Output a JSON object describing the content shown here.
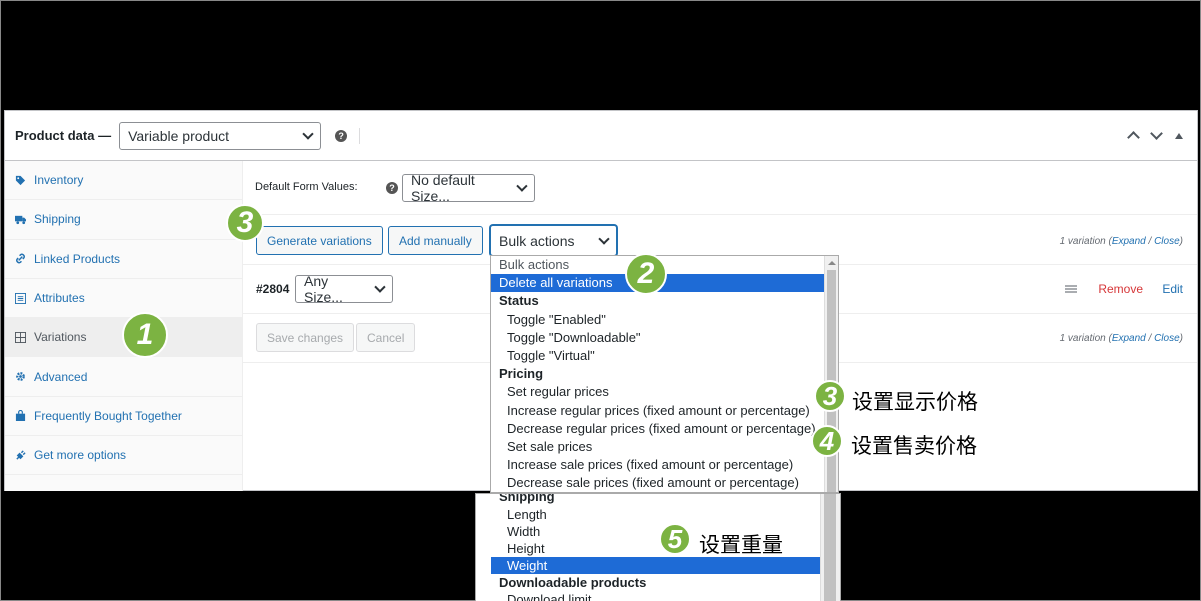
{
  "header": {
    "title": "Product data —",
    "product_type": "Variable product",
    "help": "?"
  },
  "tabs": [
    {
      "label": "Inventory",
      "icon": "tag-icon"
    },
    {
      "label": "Shipping",
      "icon": "truck-icon"
    },
    {
      "label": "Linked Products",
      "icon": "link-icon"
    },
    {
      "label": "Attributes",
      "icon": "list-icon"
    },
    {
      "label": "Variations",
      "icon": "grid-icon",
      "active": true
    },
    {
      "label": "Advanced",
      "icon": "gear-icon"
    },
    {
      "label": "Frequently Bought Together",
      "icon": "bag-icon"
    },
    {
      "label": "Get more options",
      "icon": "plugin-icon"
    }
  ],
  "default_form": {
    "label": "Default Form Values:",
    "help": "?",
    "select_value": "No default Size..."
  },
  "toolbar": {
    "generate": "Generate variations",
    "add_manually": "Add manually",
    "bulk_actions": "Bulk actions",
    "count_text": "1 variation (",
    "expand": "Expand",
    "slash": " / ",
    "close": "Close",
    "count_end": ")"
  },
  "variation": {
    "id": "#2804",
    "size": "Any Size...",
    "remove": "Remove",
    "edit": "Edit"
  },
  "footer": {
    "save": "Save changes",
    "cancel": "Cancel",
    "count_text": "1 variation (",
    "expand": "Expand",
    "slash": " / ",
    "close": "Close",
    "count_end": ")"
  },
  "dropdown": {
    "first": "Bulk actions",
    "selected": "Delete all variations",
    "status_group": "Status",
    "status_items": [
      "Toggle \"Enabled\"",
      "Toggle \"Downloadable\"",
      "Toggle \"Virtual\""
    ],
    "pricing_group": "Pricing",
    "pricing_items": [
      "Set regular prices",
      "Increase regular prices (fixed amount or percentage)",
      "Decrease regular prices (fixed amount or percentage)",
      "Set sale prices",
      "Increase sale prices (fixed amount or percentage)",
      "Decrease sale prices (fixed amount or percentage)"
    ]
  },
  "dropdown2": {
    "shipping_group": "Shipping",
    "shipping_items": [
      "Length",
      "Width",
      "Height"
    ],
    "selected": "Weight",
    "downloadable_group": "Downloadable products",
    "downloadable_items": [
      "Download limit"
    ]
  },
  "annotations": {
    "b1": "1",
    "b2": "2",
    "b3a": "3",
    "b3b": "3",
    "b4": "4",
    "b5": "5",
    "note3": "设置显示价格",
    "note4": "设置售卖价格",
    "note5": "设置重量"
  },
  "colors": {
    "accent": "#2271b1",
    "badge": "#7cb342",
    "selected": "#1e6bd6",
    "remove": "#d63638"
  }
}
